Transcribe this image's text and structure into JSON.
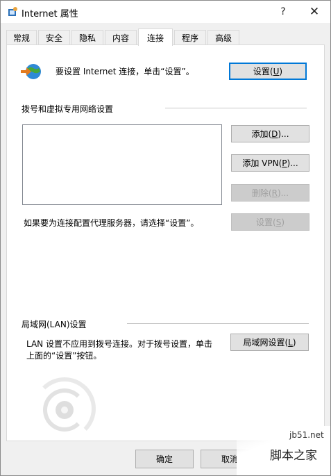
{
  "window": {
    "title": "Internet 属性",
    "help_label": "?",
    "close_label": "✕"
  },
  "tabs": [
    {
      "label": "常规"
    },
    {
      "label": "安全"
    },
    {
      "label": "隐私"
    },
    {
      "label": "内容"
    },
    {
      "label": "连接",
      "active": true
    },
    {
      "label": "程序"
    },
    {
      "label": "高级"
    }
  ],
  "setup": {
    "text": "要设置 Internet 连接，单击“设置”。",
    "button_prefix": "设置(",
    "button_key": "U",
    "button_suffix": ")"
  },
  "dialup": {
    "title": "拨号和虚拟专用网络设置",
    "add_prefix": "添加(",
    "add_key": "D",
    "add_suffix": ")...",
    "add_vpn_prefix": "添加 VPN(",
    "add_vpn_key": "P",
    "add_vpn_suffix": ")...",
    "remove_prefix": "删除(",
    "remove_key": "R",
    "remove_suffix": ")...",
    "proxy_text": "如果要为连接配置代理服务器，请选择“设置”。",
    "settings_prefix": "设置(",
    "settings_key": "S",
    "settings_suffix": ")"
  },
  "lan": {
    "title": "局域网(LAN)设置",
    "text_line1": "LAN 设置不应用到拨号连接。对于拨号设置，单击",
    "text_line2": "上面的“设置”按钮。",
    "button_prefix": "局域网设置(",
    "button_key": "L",
    "button_suffix": ")"
  },
  "footer": {
    "ok_label": "确定",
    "cancel_label": "取消"
  },
  "watermark": {
    "url": "jb51.net",
    "text": "脚本之家"
  },
  "colors": {
    "accent": "#0078d7",
    "panel": "#ffffff",
    "window": "#f0f0f0"
  }
}
